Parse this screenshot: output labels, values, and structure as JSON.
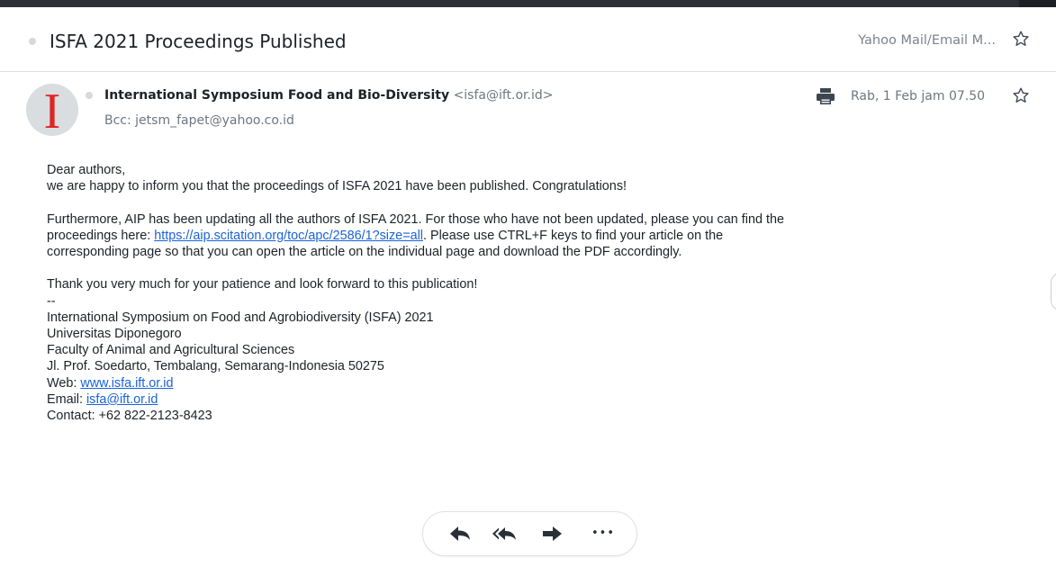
{
  "header": {
    "subject": "ISFA 2021 Proceedings Published",
    "folder": "Yahoo Mail/Email M..."
  },
  "message": {
    "avatar_letter": "I",
    "sender_name": "International Symposium Food and Bio-Diversity",
    "sender_email": "<isfa@ift.or.id>",
    "bcc": "Bcc: jetsm_fapet@yahoo.co.id",
    "date": "Rab, 1 Feb jam 07.50"
  },
  "body": {
    "greeting": "Dear authors,",
    "line1": "we are happy to inform you that the proceedings of ISFA 2021 have been published. Congratulations!",
    "p2_line1": "Furthermore, AIP has been updating all the authors of ISFA 2021. For those who have not been updated, please you can find the",
    "p2_line2_pre": "proceedings here: ",
    "p2_link": "https://aip.scitation.org/toc/apc/2586/1?size=all",
    "p2_line2_post": ". Please use CTRL+F keys to find your article on the",
    "p2_line3": "corresponding page so that you can open the article on the individual page and download the PDF accordingly.",
    "thanks": "Thank you very much for your patience and look forward to this publication!",
    "sig_sep": "--",
    "sig_org": "International Symposium on Food and Agrobiodiversity (ISFA) 2021",
    "sig_univ": "Universitas Diponegoro",
    "sig_faculty": "Faculty of Animal and Agricultural Sciences",
    "sig_address": "Jl. Prof. Soedarto, Tembalang, Semarang-Indonesia 50275",
    "web_label": "Web: ",
    "web_link": "www.isfa.ift.or.id",
    "email_label": "Email: ",
    "email_link": "isfa@ift.or.id",
    "contact": "Contact: +62 822-2123-8423"
  },
  "actions": {
    "more_label": "•••"
  },
  "colors": {
    "link": "#1a63d8",
    "avatar_letter": "#e02426",
    "muted": "#6e7780"
  },
  "icons": [
    "star-icon",
    "printer-icon",
    "reply-icon",
    "reply-all-icon",
    "forward-icon",
    "more-icon"
  ]
}
